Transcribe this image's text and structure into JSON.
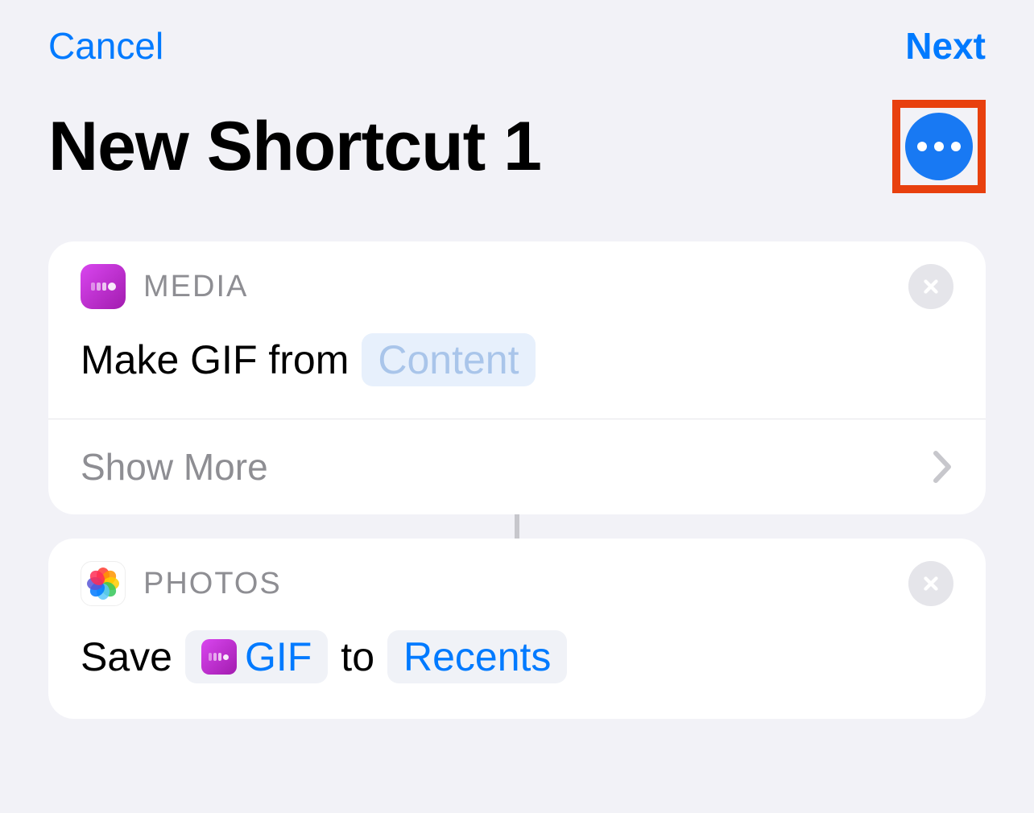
{
  "nav": {
    "cancel": "Cancel",
    "next": "Next"
  },
  "title": "New Shortcut 1",
  "actions": [
    {
      "app_label": "MEDIA",
      "prefix": "Make GIF from",
      "placeholder_token": "Content",
      "show_more": "Show More"
    },
    {
      "app_label": "PHOTOS",
      "prefix": "Save",
      "variable_token": "GIF",
      "middle": "to",
      "target_token": "Recents"
    }
  ]
}
